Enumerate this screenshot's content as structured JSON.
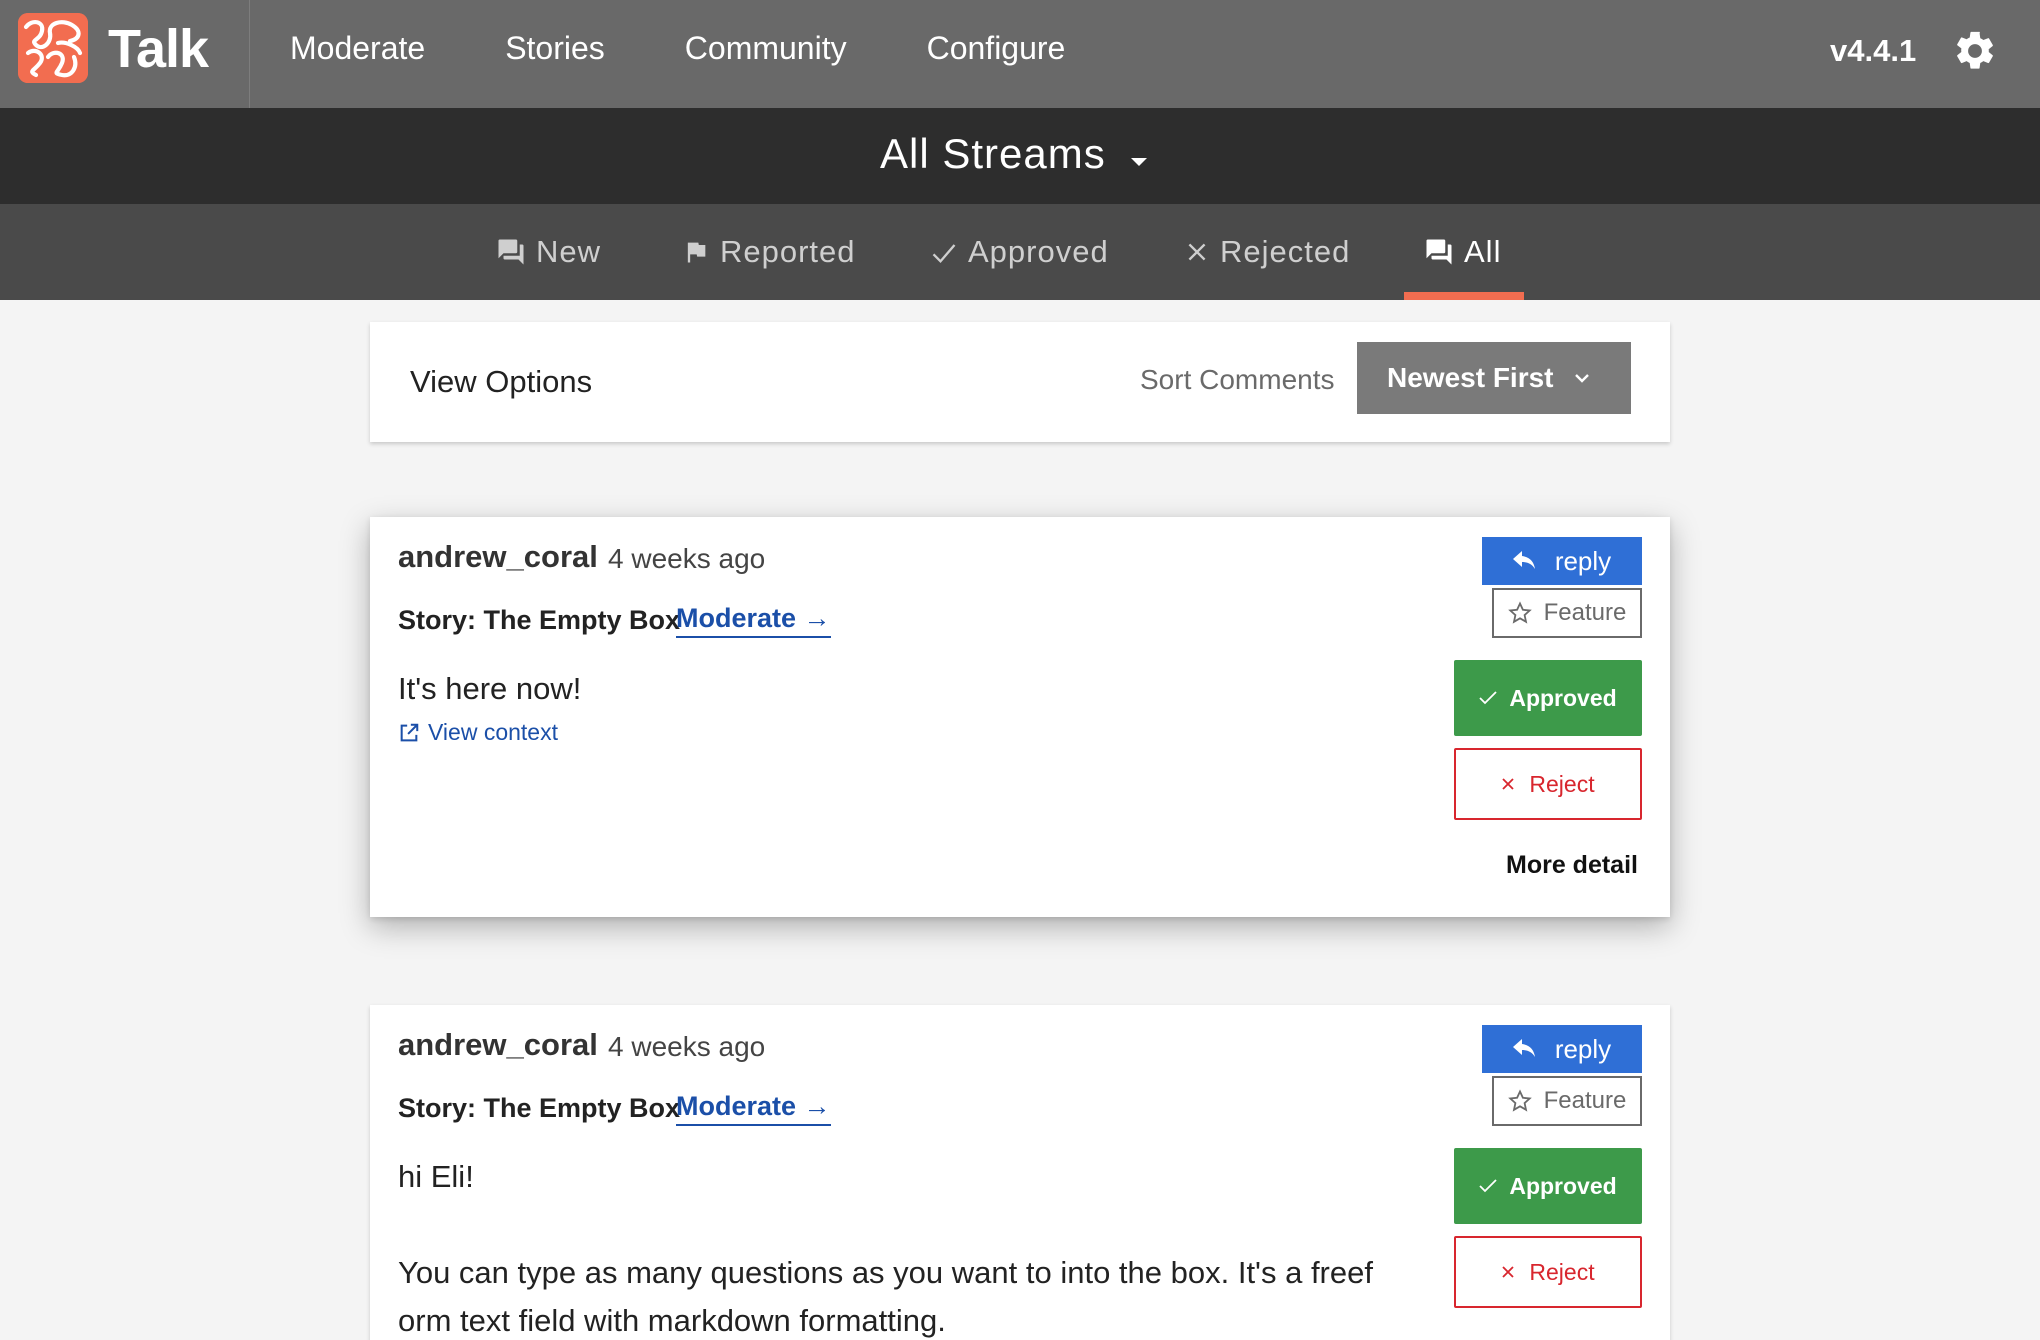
{
  "app": {
    "name": "Talk",
    "version": "v4.4.1",
    "colors": {
      "accent": "#f26d50",
      "header": "#696969",
      "streambar": "#2d2d2d",
      "tabbar": "#4a4a4a",
      "link": "#1b4fa8",
      "approve": "#3d9a4a",
      "reject": "#d8262e",
      "reply": "#2f6fd6"
    }
  },
  "nav": {
    "items": [
      {
        "label": "Moderate"
      },
      {
        "label": "Stories"
      },
      {
        "label": "Community"
      },
      {
        "label": "Configure"
      }
    ]
  },
  "stream": {
    "title": "All Streams",
    "icon": "caret-down-icon"
  },
  "tabs": [
    {
      "label": "New",
      "icon": "chat-icon"
    },
    {
      "label": "Reported",
      "icon": "flag-icon"
    },
    {
      "label": "Approved",
      "icon": "check-icon"
    },
    {
      "label": "Rejected",
      "icon": "close-icon"
    },
    {
      "label": "All",
      "icon": "chat-icon",
      "active": true
    }
  ],
  "view_options": {
    "title": "View Options",
    "sort_label": "Sort Comments",
    "sort_value": "Newest First"
  },
  "comments": [
    {
      "author": "andrew_coral",
      "time": "4 weeks ago",
      "story": "Story: The Empty Box",
      "moderate_link": "Moderate →",
      "body": [
        "It's here now!"
      ],
      "view_context": "View context",
      "reply_label": "reply",
      "feature_label": "Feature",
      "approved_label": "Approved",
      "reject_label": "Reject",
      "more_detail": "More detail"
    },
    {
      "author": "andrew_coral",
      "time": "4 weeks ago",
      "story": "Story: The Empty Box",
      "moderate_link": "Moderate →",
      "body": [
        "hi Eli!",
        "You can type as many questions as you want to into the box. It's a freef orm text field with markdown formatting."
      ],
      "reply_label": "reply",
      "feature_label": "Feature",
      "approved_label": "Approved",
      "reject_label": "Reject"
    }
  ]
}
